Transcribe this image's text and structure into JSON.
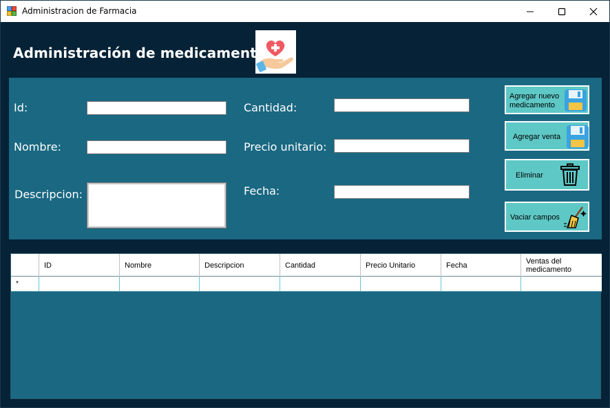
{
  "window": {
    "title": "Administracion de Farmacia"
  },
  "header": {
    "title": "Administración de medicamentos",
    "logo_icon": "heart-hand-care-icon"
  },
  "form": {
    "labels": {
      "id": "Id:",
      "nombre": "Nombre:",
      "descripcion": "Descripcion:",
      "cantidad": "Cantidad:",
      "precio": "Precio unitario:",
      "fecha": "Fecha:"
    },
    "values": {
      "id": "",
      "nombre": "",
      "descripcion": "",
      "cantidad": "",
      "precio": "",
      "fecha": ""
    }
  },
  "actions": {
    "agregar_medicamento": "Agregar nuevo medicamento",
    "agregar_venta": "Agregar venta",
    "eliminar": "Eliminar",
    "vaciar": "Vaciar campos"
  },
  "grid": {
    "columns": [
      "ID",
      "Nombre",
      "Descripcion",
      "Cantidad",
      "Precio Unitario",
      "Fecha",
      "Ventas del medicamento"
    ],
    "new_row_marker": "*"
  },
  "colors": {
    "background": "#062236",
    "panel": "#1a6882",
    "button": "#5ec8c6"
  }
}
